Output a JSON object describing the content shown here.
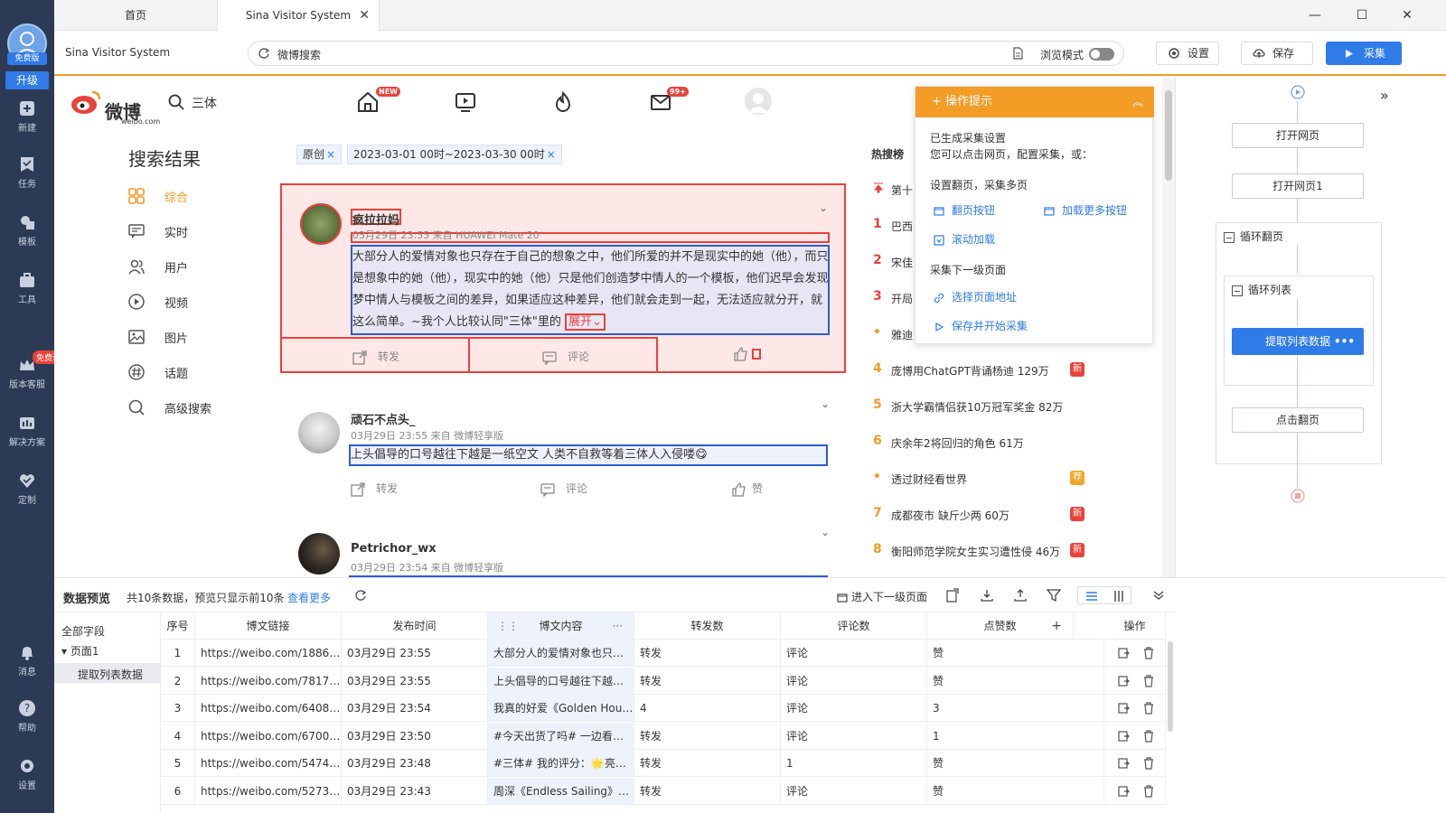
{
  "rail": {
    "badge": "免费版",
    "upgrade": "升级",
    "items": [
      "新建",
      "任务",
      "模板",
      "工具",
      "版本客服",
      "解决方案",
      "定制",
      "消息",
      "帮助",
      "设置"
    ],
    "free_trial": "免费试用"
  },
  "tabs": {
    "home": "首页",
    "active": "Sina Visitor System",
    "close": "✕"
  },
  "window": {
    "minimize": "—",
    "maximize": "☐",
    "close": "✕"
  },
  "addr": {
    "site": "Sina Visitor System",
    "url": "微博搜索",
    "browse_mode": "浏览模式",
    "settings": "设置",
    "save": "保存",
    "collect": "采集"
  },
  "weibo": {
    "logo": "微博",
    "logo_sub": "weibo.com",
    "search_term": "三体",
    "badge_new": "NEW",
    "badge_mail": "99+",
    "results_title": "搜索结果",
    "side_nav": [
      "综合",
      "实时",
      "用户",
      "视频",
      "图片",
      "话题",
      "高级搜索"
    ],
    "filters": [
      "原创",
      "2023-03-01 00时~2023-03-30 00时"
    ],
    "chip_x": "×",
    "posts": [
      {
        "name": "疯拉拉妈",
        "meta": "03月29日 23:55 来自 HUAWEI Mate 20",
        "body": "大部分人的爱情对象也只存在于自己的想象之中，他们所爱的并不是现实中的她（他），而只是想象中的她（他），现实中的她（他）只是他们创造梦中情人的一个模板，他们迟早会发现梦中情人与模板之间的差异，如果适应这种差异，他们就会走到一起，无法适应就分开，就这么简单。~我个人比较认同\"三体\"里的",
        "expand": "展开",
        "forward": "转发",
        "comment": "评论"
      },
      {
        "name": "顽石不点头_",
        "meta": "03月29日 23:55 来自 微博轻享版",
        "body": "上头倡导的口号越往下越是一纸空文 人类不自救等着三体人入侵喽😋",
        "forward": "转发",
        "comment": "评论",
        "like": "赞"
      },
      {
        "name": "Petrichor_wx",
        "meta": "03月29日 23:54 来自 微博轻享版"
      }
    ],
    "hot_title": "热搜榜",
    "hot": [
      {
        "rank": "",
        "text": "第十",
        "tag": ""
      },
      {
        "rank": "1",
        "text": "巴西",
        "tag": ""
      },
      {
        "rank": "2",
        "text": "宋佳",
        "tag": ""
      },
      {
        "rank": "3",
        "text": "开局",
        "tag": ""
      },
      {
        "rank": "•",
        "text": "雅迪",
        "tag": ""
      },
      {
        "rank": "4",
        "text": "庞博用ChatGPT背诵杨迪  129万",
        "tag": "新"
      },
      {
        "rank": "5",
        "text": "浙大学霸情侣获10万冠军奖金  82万",
        "tag": ""
      },
      {
        "rank": "6",
        "text": "庆余年2将回归的角色  61万",
        "tag": ""
      },
      {
        "rank": "•",
        "text": "透过财经看世界",
        "tag": "荐"
      },
      {
        "rank": "7",
        "text": "成都夜市 缺斤少两  60万",
        "tag": "新"
      },
      {
        "rank": "8",
        "text": "衡阳师范学院女生实习遭性侵  46万",
        "tag": "新"
      }
    ]
  },
  "tips": {
    "title": "操作提示",
    "collapse": "︽",
    "line1": "已生成采集设置",
    "line2": "您可以点击网页，配置采集，或：",
    "section1": "设置翻页，采集多页",
    "link_page_btn": "翻页按钮",
    "link_load_more": "加载更多按钮",
    "link_scroll": "滚动加载",
    "section2": "采集下一级页面",
    "link_select_url": "选择页面地址",
    "link_save_start": "保存并开始采集"
  },
  "flow": {
    "expand": "»",
    "open1": "打开网页",
    "open2": "打开网页1",
    "loop_page": "循环翻页",
    "loop_list": "循环列表",
    "extract": "提取列表数据",
    "more": "•••",
    "click_page": "点击翻页"
  },
  "preview": {
    "title": "数据预览",
    "count": "共10条数据，预览只显示前10条",
    "more": "查看更多",
    "next_level": "进入下一级页面",
    "tree_all": "全部字段",
    "tree_page": "页面1",
    "tree_extract": "提取列表数据",
    "columns": [
      "序号",
      "博文链接",
      "发布时间",
      "博文内容",
      "转发数",
      "评论数",
      "点赞数",
      "+",
      "操作"
    ],
    "rows": [
      [
        "1",
        "https://weibo.com/188698...",
        "03月29日 23:55",
        "大部分人的爱情对象也只存...",
        "转发",
        "评论",
        "赞"
      ],
      [
        "2",
        "https://weibo.com/781777...",
        "03月29日 23:55",
        "上头倡导的口号越往下越是...",
        "转发",
        "评论",
        "赞"
      ],
      [
        "3",
        "https://weibo.com/640841...",
        "03月29日 23:54",
        "我真的好爱《Golden Hour...",
        "4",
        "评论",
        "3"
      ],
      [
        "4",
        "https://weibo.com/670042...",
        "03月29日 23:50",
        "#今天出货了吗# 一边看三...",
        "转发",
        "评论",
        "1"
      ],
      [
        "5",
        "https://weibo.com/547449...",
        "03月29日 23:48",
        "#三体# 我的评分：🌟亮点...",
        "转发",
        "1",
        "赞"
      ],
      [
        "6",
        "https://weibo.com/527332...",
        "03月29日 23:43",
        "周深《Endless Sailing》（...",
        "转发",
        "评论",
        "赞"
      ]
    ]
  },
  "colors": {
    "accent": "#2f7be8",
    "orange": "#f39c26",
    "red": "#e8433a",
    "rail": "#2c3a55"
  }
}
